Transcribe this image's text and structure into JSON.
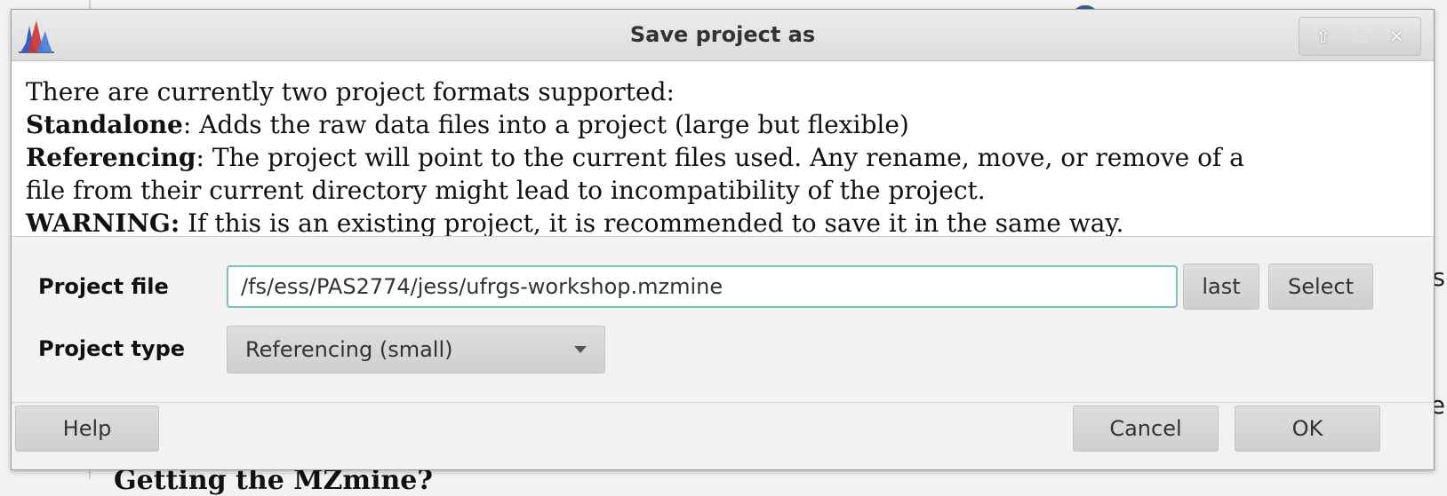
{
  "window": {
    "title": "Save project as"
  },
  "info": {
    "intro": "There are currently two project formats supported:",
    "standalone_term": "Standalone",
    "standalone_desc": ": Adds the raw data files into a project (large but flexible)",
    "referencing_term": "Referencing",
    "referencing_desc": ": The project will point to the current files used. Any rename, move, or remove of a",
    "referencing_desc_2": "file from their current directory might lead to incompatibility of the project.",
    "warning_term": "WARNING:",
    "warning_desc": " If this is an existing project, it is recommended to save it in the same way."
  },
  "form": {
    "project_file_label": "Project file",
    "project_file_value": "/fs/ess/PAS2774/jess/ufrgs-workshop.mzmine",
    "last_button": "last",
    "select_button": "Select",
    "project_type_label": "Project type",
    "project_type_value": "Referencing (small)"
  },
  "footer": {
    "help_button": "Help",
    "cancel_button": "Cancel",
    "ok_button": "OK"
  },
  "background": {
    "edge_char_1": "s",
    "edge_char_2": "e",
    "bottom_text": "Getting the MZmine?"
  },
  "colors": {
    "field_focus_border": "#79c0b8",
    "app_icon_blue": "#2a62c9",
    "app_icon_red": "#d0332b"
  },
  "icons": {
    "app": "mzmine-chromatogram-icon",
    "shade": "shade-up-icon",
    "maximize": "maximize-icon",
    "close": "close-icon",
    "dropdown": "chevron-down-icon"
  }
}
